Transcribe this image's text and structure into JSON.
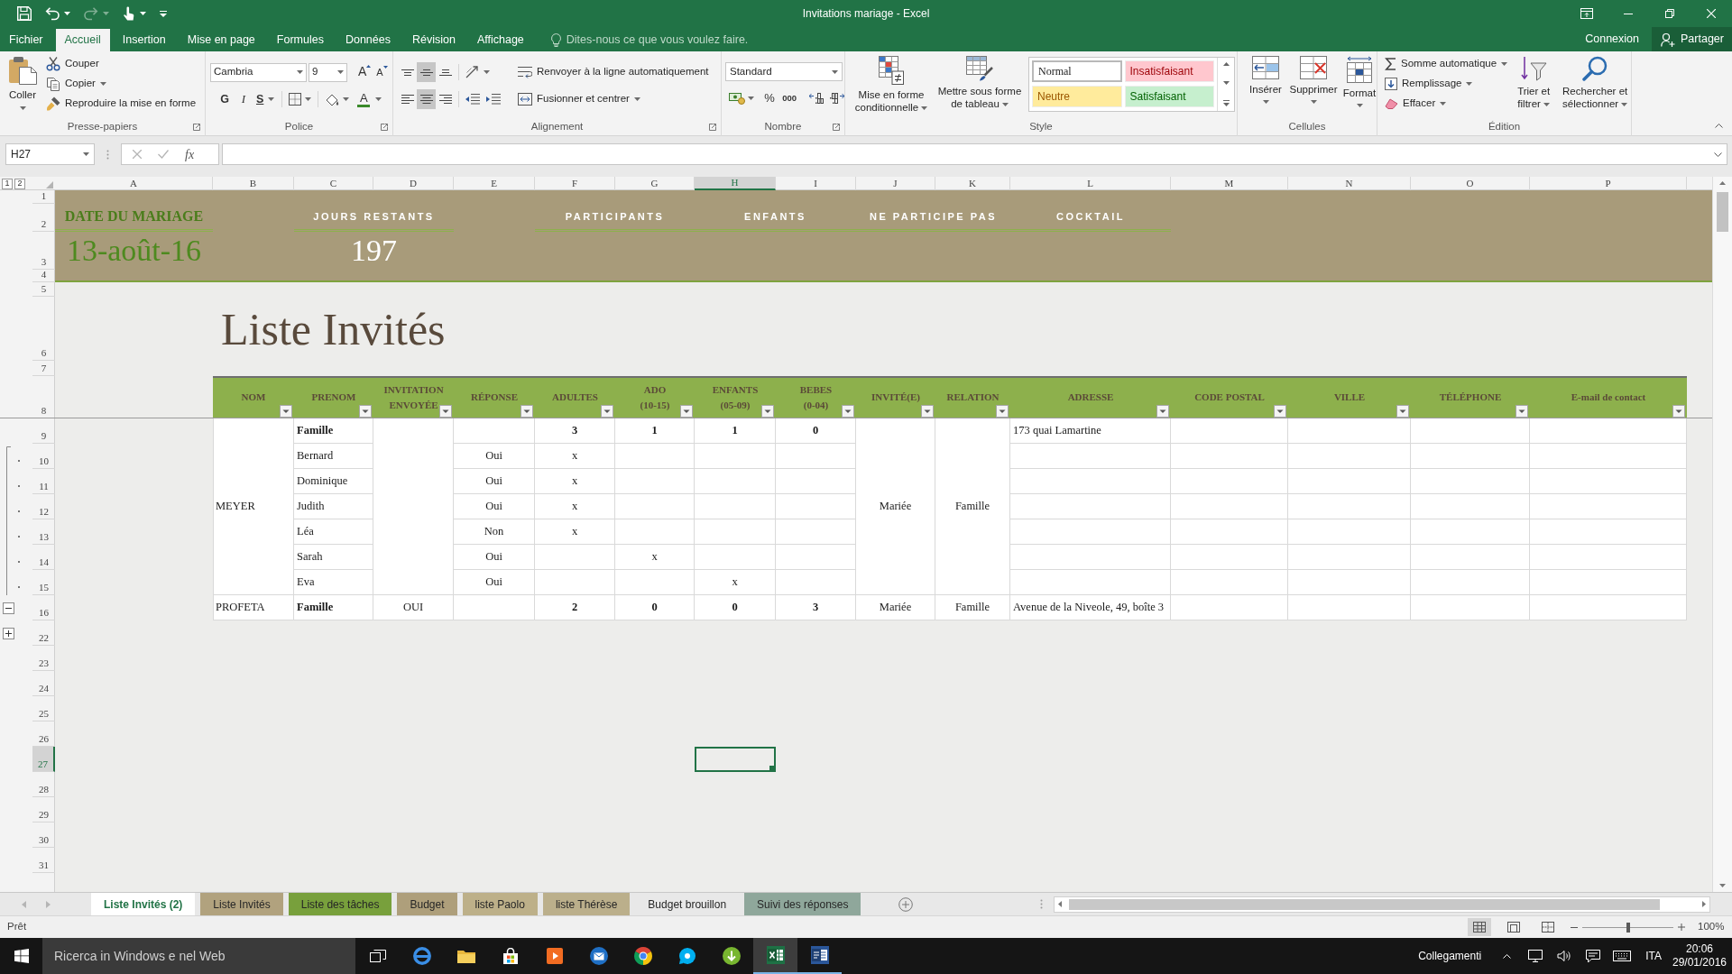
{
  "title_bar": {
    "title": "Invitations mariage - Excel",
    "quick_access": [
      {
        "kind": "save",
        "disabled": false
      },
      {
        "kind": "undo",
        "disabled": false
      },
      {
        "kind": "redo",
        "disabled": true
      },
      {
        "kind": "touch",
        "disabled": false
      },
      {
        "kind": "customize",
        "disabled": false
      }
    ]
  },
  "menu_tabs": [
    {
      "label": "Fichier",
      "selected": false
    },
    {
      "label": "Accueil",
      "selected": true
    },
    {
      "label": "Insertion",
      "selected": false
    },
    {
      "label": "Mise en page",
      "selected": false
    },
    {
      "label": "Formules",
      "selected": false
    },
    {
      "label": "Données",
      "selected": false
    },
    {
      "label": "Révision",
      "selected": false
    },
    {
      "label": "Affichage",
      "selected": false
    }
  ],
  "tell_me": {
    "placeholder": "Dites-nous ce que vous voulez faire."
  },
  "account": {
    "sign_in": "Connexion",
    "share": "Partager"
  },
  "ribbon": {
    "clipboard": {
      "label": "Presse-papiers",
      "paste": "Coller",
      "cut": "Couper",
      "copy": "Copier",
      "format_painter": "Reproduire la mise en forme"
    },
    "font": {
      "label": "Police",
      "font_name": "Cambria",
      "font_size": "9",
      "grow_font": "A",
      "shrink_font": "A",
      "bold": "G",
      "italic": "I",
      "underline": "S",
      "font_color": "A"
    },
    "alignment": {
      "label": "Alignement",
      "vertical": [
        {
          "kind": "top",
          "selected": false
        },
        {
          "kind": "middle",
          "selected": true
        },
        {
          "kind": "bottom",
          "selected": false
        }
      ],
      "horizontal": [
        {
          "kind": "left",
          "selected": false
        },
        {
          "kind": "center",
          "selected": true
        },
        {
          "kind": "right",
          "selected": false
        }
      ],
      "wrap_text": "Renvoyer à la ligne automatiquement",
      "merge": "Fusionner et centrer"
    },
    "number": {
      "label": "Nombre",
      "format": "Standard",
      "percent": "%",
      "thousands": "000"
    },
    "styles": {
      "label": "Style",
      "conditional": "Mise en forme\nconditionnelle",
      "format_as_table": "Mettre sous forme\nde tableau",
      "gallery": [
        {
          "label": "Normal",
          "kind": "normal",
          "selected": true
        },
        {
          "label": "Insatisfaisant",
          "kind": "bad",
          "selected": false
        },
        {
          "label": "Neutre",
          "kind": "neutral",
          "selected": false
        },
        {
          "label": "Satisfaisant",
          "kind": "good",
          "selected": false
        }
      ]
    },
    "cells": {
      "label": "Cellules",
      "insert": "Insérer",
      "delete": "Supprimer",
      "format": "Format"
    },
    "editing": {
      "label": "Édition",
      "autosum": "Somme automatique",
      "fill": "Remplissage",
      "clear": "Effacer",
      "sort_filter": "Trier et\nfiltrer",
      "find_select": "Rechercher et\nsélectionner"
    }
  },
  "formula_bar": {
    "name_box": "H27",
    "buttons": [
      {
        "kind": "cancel",
        "disabled": true
      },
      {
        "kind": "enter",
        "disabled": true
      }
    ],
    "function_button": "fx"
  },
  "sheet": {
    "outline_levels": [
      "1",
      "2"
    ],
    "outline_groups": [
      {
        "expanded": true
      },
      {
        "expanded": false
      }
    ],
    "columns": [
      {
        "label": "A",
        "selected": false
      },
      {
        "label": "B",
        "selected": false
      },
      {
        "label": "C",
        "selected": false
      },
      {
        "label": "D",
        "selected": false
      },
      {
        "label": "E",
        "selected": false
      },
      {
        "label": "F",
        "selected": false
      },
      {
        "label": "G",
        "selected": false
      },
      {
        "label": "H",
        "selected": true
      },
      {
        "label": "I",
        "selected": false
      },
      {
        "label": "J",
        "selected": false
      },
      {
        "label": "K",
        "selected": false
      },
      {
        "label": "L",
        "selected": false
      },
      {
        "label": "M",
        "selected": false
      },
      {
        "label": "N",
        "selected": false
      },
      {
        "label": "O",
        "selected": false
      },
      {
        "label": "P",
        "selected": false
      }
    ],
    "rows": [
      {
        "label": "1",
        "selected": false
      },
      {
        "label": "2",
        "selected": false
      },
      {
        "label": "3",
        "selected": false
      },
      {
        "label": "4",
        "selected": false
      },
      {
        "label": "5",
        "selected": false
      },
      {
        "label": "6",
        "selected": false
      },
      {
        "label": "7",
        "selected": false
      },
      {
        "label": "8",
        "selected": false
      },
      {
        "label": "9",
        "selected": false
      },
      {
        "label": "10",
        "selected": false
      },
      {
        "label": "11",
        "selected": false
      },
      {
        "label": "12",
        "selected": false
      },
      {
        "label": "13",
        "selected": false
      },
      {
        "label": "14",
        "selected": false
      },
      {
        "label": "15",
        "selected": false
      },
      {
        "label": "16",
        "selected": false
      },
      {
        "label": "22",
        "selected": false
      },
      {
        "label": "23",
        "selected": false
      },
      {
        "label": "24",
        "selected": false
      },
      {
        "label": "25",
        "selected": false
      },
      {
        "label": "26",
        "selected": false
      },
      {
        "label": "27",
        "selected": true
      },
      {
        "label": "28",
        "selected": false
      },
      {
        "label": "29",
        "selected": false
      },
      {
        "label": "30",
        "selected": false
      },
      {
        "label": "31",
        "selected": false
      }
    ],
    "banner": {
      "date_label": "DATE DU MARIAGE",
      "date": "13-août-16",
      "days_label": "JOURS RESTANTS",
      "days": "197",
      "participants": "PARTICIPANTS",
      "children": "ENFANTS",
      "not_attending": "NE PARTICIPE PAS",
      "cocktail": "COCKTAIL"
    },
    "heading": "Liste Invités",
    "table": {
      "columns": [
        "NOM",
        "PRENOM",
        "INVITATION\nENVOYÉE",
        "RÉPONSE",
        "ADULTES",
        "ADO\n(10-15)",
        "ENFANTS\n(05-09)",
        "BEBES\n(0-04)",
        "INVITÉ(E)",
        "RELATION",
        "ADRESSE",
        "CODE POSTAL",
        "VILLE",
        "TÉLÉPHONE",
        "E-mail de contact"
      ],
      "groups": [
        {
          "nom": "MEYER",
          "invite": "Mariée",
          "relation": "Famille",
          "rows": [
            {
              "kind": "total",
              "prenom": "Famille",
              "adultes": "3",
              "ado": "1",
              "enfants": "1",
              "bebes": "0",
              "adresse": "173 quai Lamartine"
            },
            {
              "kind": "member",
              "prenom": "Bernard",
              "reponse": "Oui",
              "adultes": "x"
            },
            {
              "kind": "member",
              "prenom": "Dominique",
              "reponse": "Oui",
              "adultes": "x"
            },
            {
              "kind": "member",
              "prenom": "Judith",
              "reponse": "Oui",
              "adultes": "x"
            },
            {
              "kind": "member",
              "prenom": "Léa",
              "reponse": "Non",
              "adultes": "x"
            },
            {
              "kind": "member",
              "prenom": "Sarah",
              "reponse": "Oui",
              "ado": "x"
            },
            {
              "kind": "member",
              "prenom": "Eva",
              "reponse": "Oui",
              "enfants": "x"
            }
          ]
        },
        {
          "nom": "PROFETA",
          "invitation": "OUI",
          "invite": "Mariée",
          "relation": "Famille",
          "rows": [
            {
              "kind": "total",
              "prenom": "Famille",
              "adultes": "2",
              "ado": "0",
              "enfants": "0",
              "bebes": "3",
              "adresse": "Avenue de la Niveole, 49, boîte 3"
            }
          ]
        }
      ]
    }
  },
  "sheet_tabs": [
    {
      "label": "Liste Invités (2)",
      "selected": true
    },
    {
      "label": "Liste Invités",
      "selected": false,
      "color": "#b1a27e"
    },
    {
      "label": "Liste des tâches",
      "selected": false,
      "color": "#78a03c"
    },
    {
      "label": "Budget",
      "selected": false,
      "color": "#ae9f7b"
    },
    {
      "label": "liste Paolo",
      "selected": false,
      "color": "#bdb089"
    },
    {
      "label": "liste Thérèse",
      "selected": false,
      "color": "#bbaf8b"
    },
    {
      "label": "Budget brouillon",
      "selected": false
    },
    {
      "label": "Suivi des réponses",
      "selected": false,
      "color": "#8fa79b"
    }
  ],
  "status_bar": {
    "status": "Prêt",
    "views": [
      {
        "kind": "normal",
        "selected": true
      },
      {
        "kind": "page_layout",
        "selected": false
      },
      {
        "kind": "page_break",
        "selected": false
      }
    ],
    "zoom": {
      "label": "100%",
      "level": 0.5
    }
  },
  "taskbar": {
    "search": {
      "placeholder": "Ricerca in Windows e nel Web"
    },
    "apps": [
      {
        "kind": "task_view",
        "open": false,
        "selected": false
      },
      {
        "kind": "browser",
        "open": false,
        "selected": false
      },
      {
        "kind": "files",
        "open": false,
        "selected": false
      },
      {
        "kind": "store",
        "open": false,
        "selected": false
      },
      {
        "kind": "media",
        "open": false,
        "selected": false
      },
      {
        "kind": "mail",
        "open": false,
        "selected": false
      },
      {
        "kind": "web",
        "open": false,
        "selected": false
      },
      {
        "kind": "chat",
        "open": false,
        "selected": false
      },
      {
        "kind": "download",
        "open": false,
        "selected": false
      },
      {
        "kind": "spreadsheet",
        "open": true,
        "selected": true
      },
      {
        "kind": "document",
        "open": true,
        "selected": false
      }
    ],
    "tray": {
      "links": "Collegamenti",
      "language": "ITA",
      "time": "20:06",
      "date": "29/01/2016"
    }
  }
}
